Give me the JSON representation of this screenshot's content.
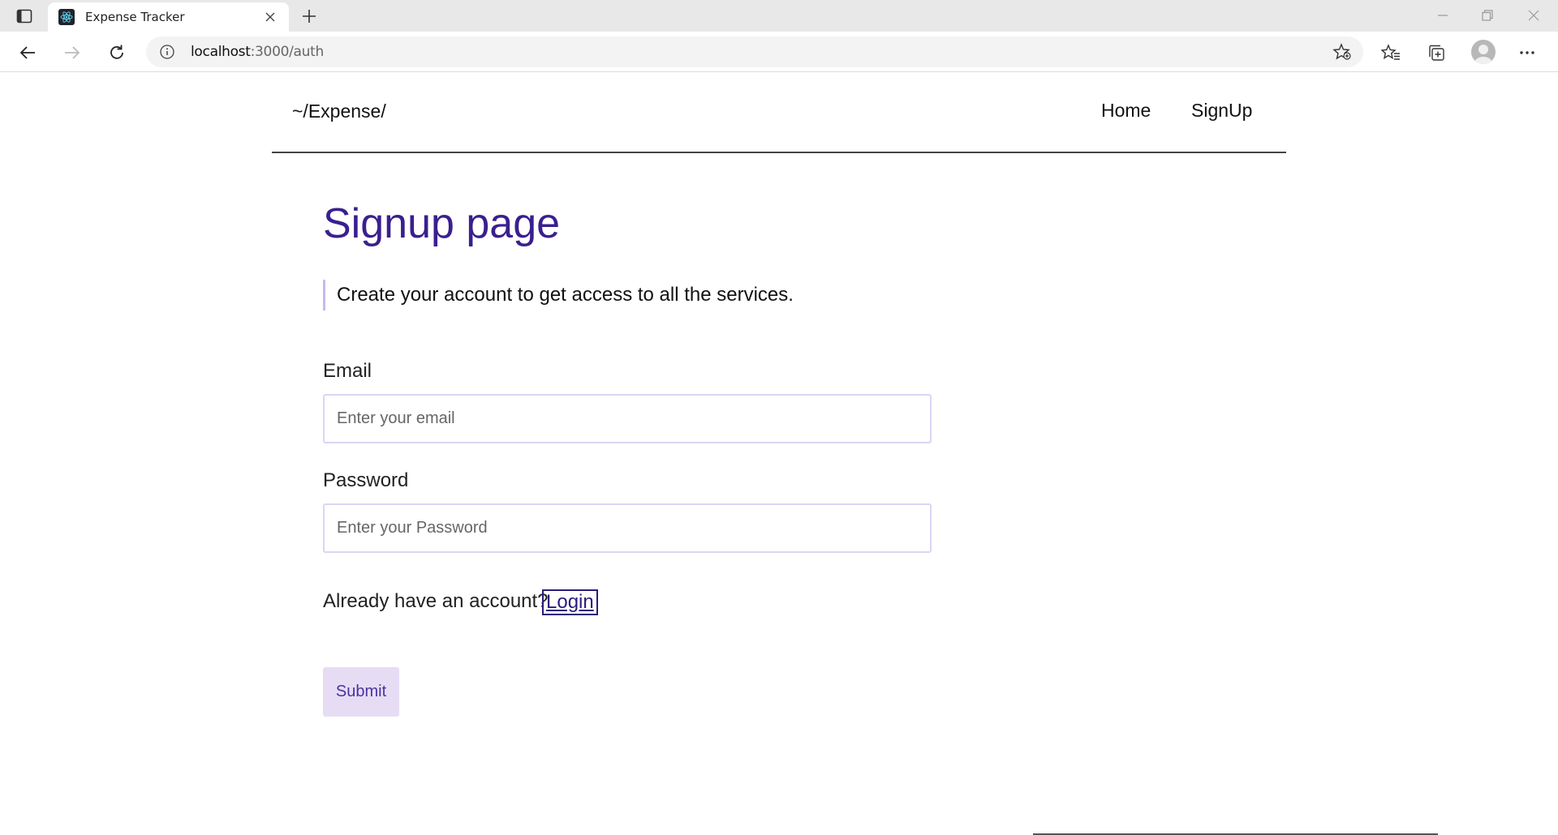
{
  "browser": {
    "tab_title": "Expense Tracker",
    "url_host": "localhost",
    "url_path": ":3000/auth"
  },
  "navbar": {
    "brand": "~/Expense/",
    "links": [
      "Home",
      "SignUp"
    ]
  },
  "main": {
    "title": "Signup page",
    "subtitle": "Create your account to get access to all the services.",
    "email_label": "Email",
    "email_placeholder": "Enter your email",
    "password_label": "Password",
    "password_placeholder": "Enter your Password",
    "already_text": "Already have an account?",
    "login_label": "Login",
    "submit_label": "Submit"
  },
  "colors": {
    "title": "#3a1f8f",
    "submit_bg": "#e6ddf5",
    "link_border": "#2d1a7a"
  }
}
